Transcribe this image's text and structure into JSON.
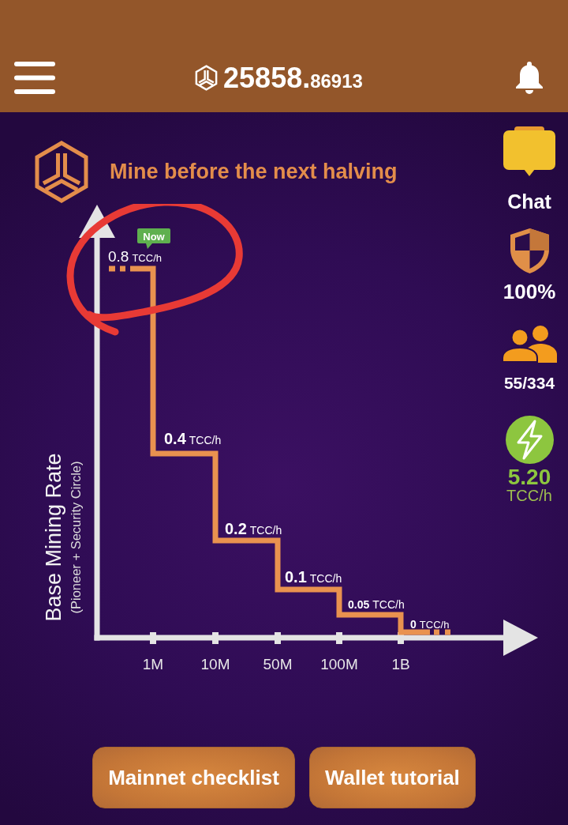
{
  "top_bar": {
    "balance_integer": "25858.",
    "balance_fraction": "86913"
  },
  "title": "Mine before the next halving",
  "chart": {
    "y_title": "Base Mining Rate",
    "y_subtitle": "(Pioneer + Security Circle)",
    "x_labels": [
      "1M",
      "10M",
      "50M",
      "100M",
      "1B"
    ],
    "steps": [
      {
        "value": "0.8",
        "unit": "TCC/h",
        "current": true,
        "badge": "Now"
      },
      {
        "value": "0.4",
        "unit": "TCC/h",
        "current": false
      },
      {
        "value": "0.2",
        "unit": "TCC/h",
        "current": false
      },
      {
        "value": "0.1",
        "unit": "TCC/h",
        "current": false
      },
      {
        "value": "0.05",
        "unit": "TCC/h",
        "current": false
      },
      {
        "value": "0",
        "unit": "TCC/h",
        "current": false
      }
    ]
  },
  "sidebar": [
    {
      "kind": "chat",
      "label": "Chat"
    },
    {
      "kind": "security",
      "label": "100%"
    },
    {
      "kind": "referrals",
      "label": "55/334"
    },
    {
      "kind": "mining",
      "value": "5.20",
      "unit": "TCC/h"
    }
  ],
  "buttons": [
    "Mainnet checklist",
    "Wallet tutorial"
  ]
}
